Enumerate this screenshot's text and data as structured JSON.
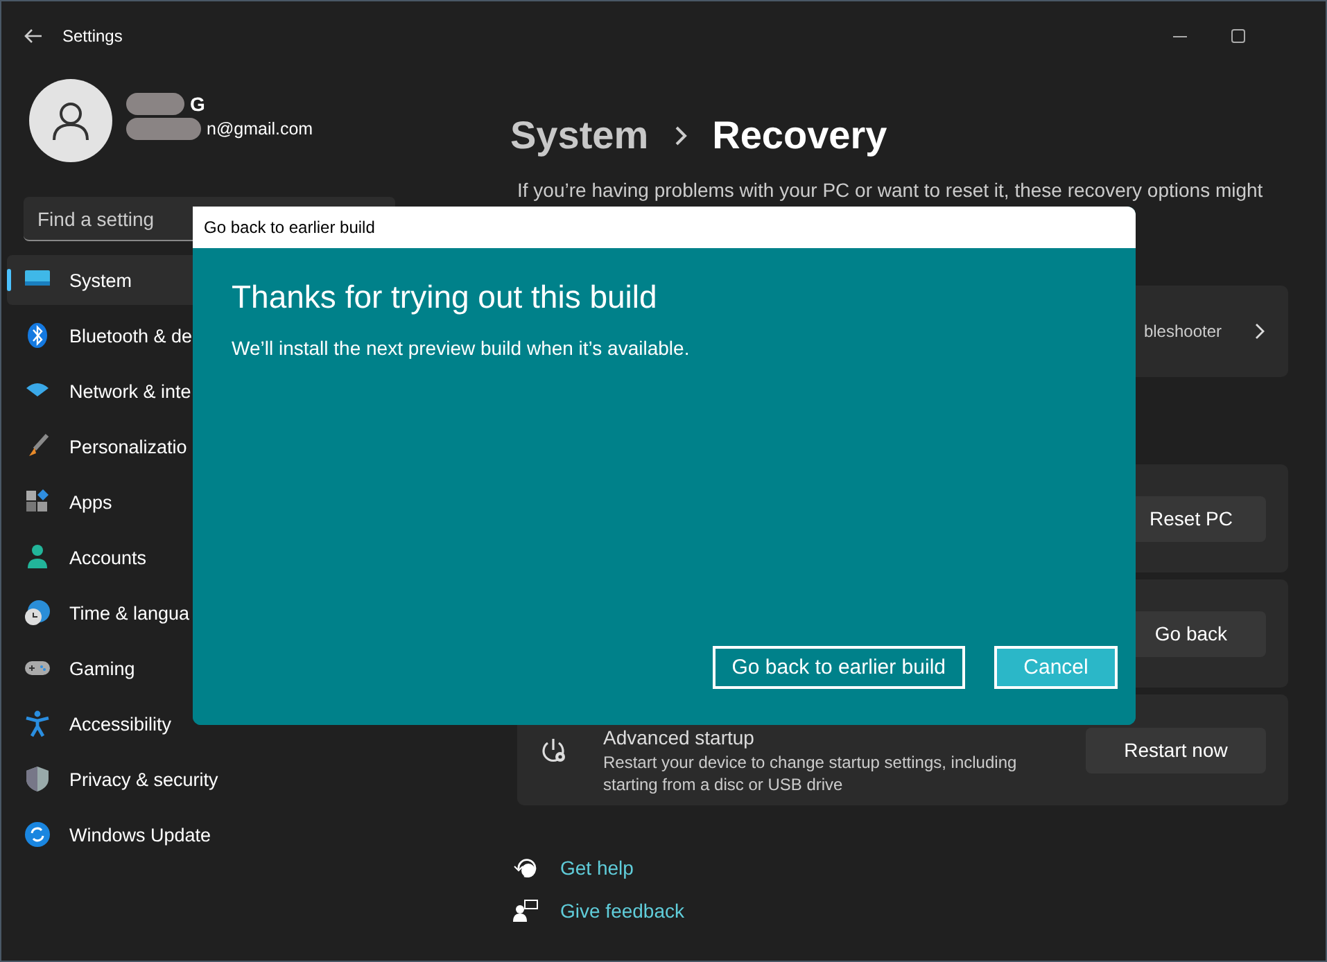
{
  "window": {
    "title": "Settings"
  },
  "account": {
    "name": "G",
    "email": "n@gmail.com"
  },
  "search": {
    "placeholder": "Find a setting"
  },
  "sidebar": {
    "items": [
      {
        "label": "System",
        "selected": true
      },
      {
        "label": "Bluetooth & de",
        "selected": false
      },
      {
        "label": "Network & inte",
        "selected": false
      },
      {
        "label": "Personalizatio",
        "selected": false
      },
      {
        "label": "Apps",
        "selected": false
      },
      {
        "label": "Accounts",
        "selected": false
      },
      {
        "label": "Time & langua",
        "selected": false
      },
      {
        "label": "Gaming",
        "selected": false
      },
      {
        "label": "Accessibility",
        "selected": false
      },
      {
        "label": "Privacy & security",
        "selected": false
      },
      {
        "label": "Windows Update",
        "selected": false
      }
    ]
  },
  "breadcrumb": {
    "parent": "System",
    "current": "Recovery"
  },
  "description": "If you’re having problems with your PC or want to reset it, these recovery options might",
  "cards": [
    {
      "kind": "link",
      "subtitle": "bleshooter"
    },
    {
      "kind": "button",
      "button": "Reset PC"
    },
    {
      "kind": "button",
      "button": "Go back"
    },
    {
      "kind": "button",
      "title": "Advanced startup",
      "subtitle": "Restart your device to change startup settings, including starting from a disc or USB drive",
      "button": "Restart now"
    }
  ],
  "links": [
    {
      "label": "Get help"
    },
    {
      "label": "Give feedback"
    }
  ],
  "dialog": {
    "title": "Go back to earlier build",
    "heading": "Thanks for trying out this build",
    "message": "We’ll install the next preview build when it’s available.",
    "buttons": [
      {
        "label": "Go back to earlier build",
        "primary": false
      },
      {
        "label": "Cancel",
        "primary": true
      }
    ]
  }
}
